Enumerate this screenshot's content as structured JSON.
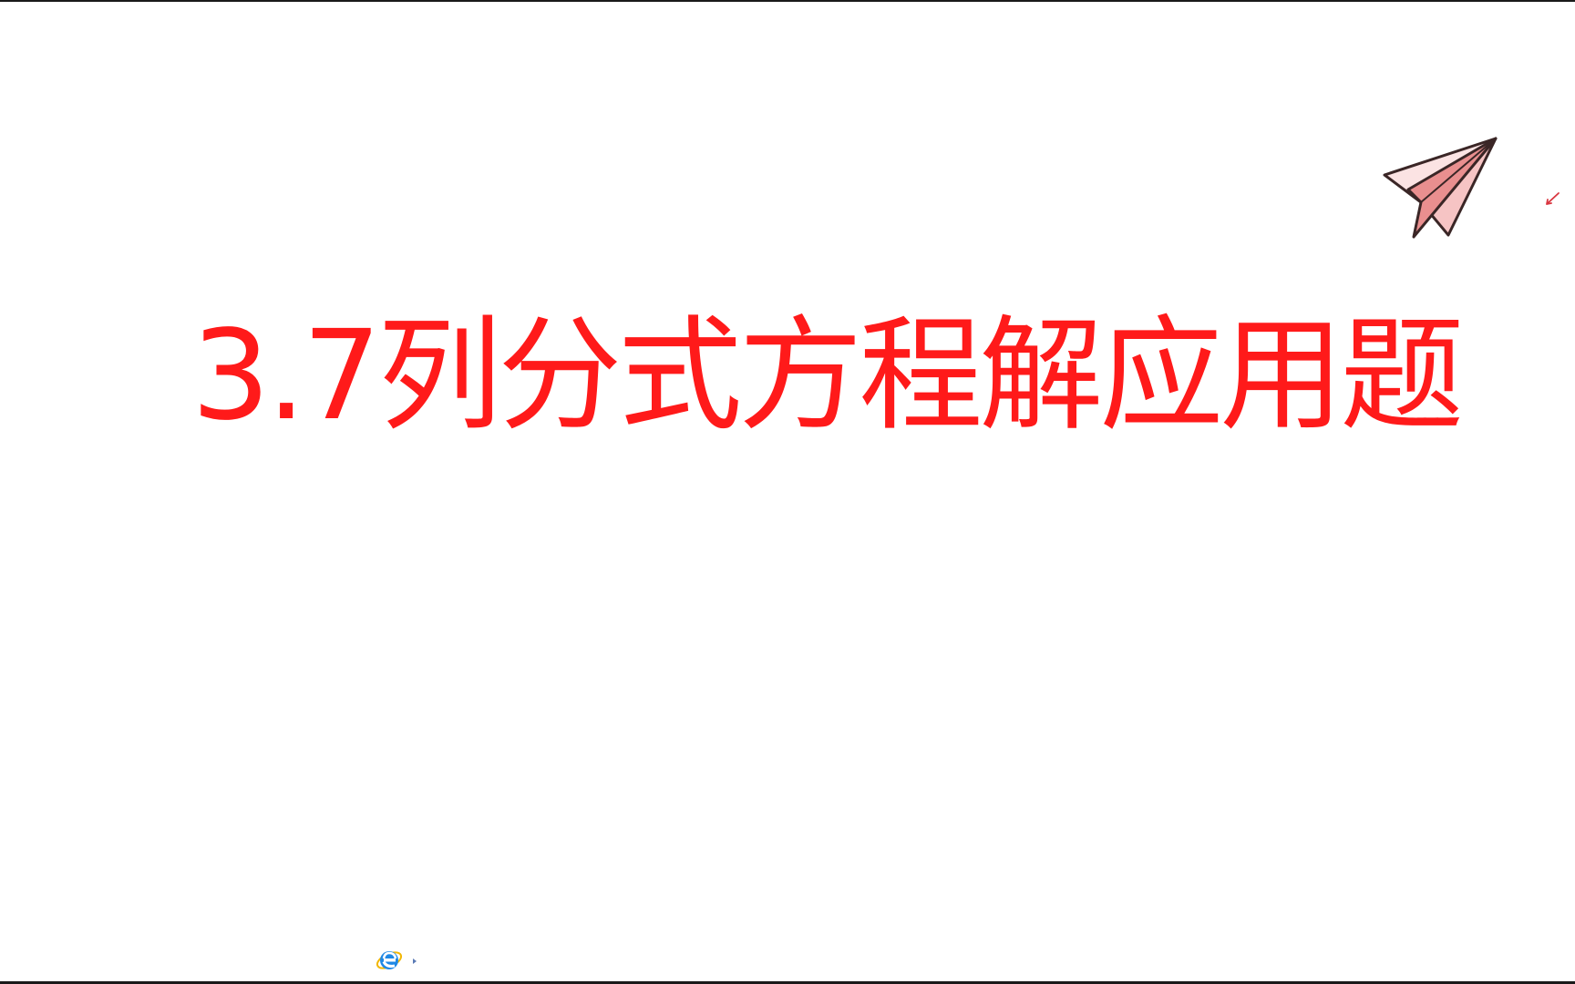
{
  "slide": {
    "title": "3.7列分式方程解应用题",
    "title_color": "#ff1a1a"
  },
  "icons": {
    "decoration": "paper-plane-icon",
    "annotation": "pen-mark-icon",
    "taskbar": "internet-explorer-icon"
  },
  "colors": {
    "background": "#ffffff",
    "plane_fill": "#f3b6b6",
    "plane_outline": "#3a2626",
    "ie_blue": "#1e88e5"
  }
}
